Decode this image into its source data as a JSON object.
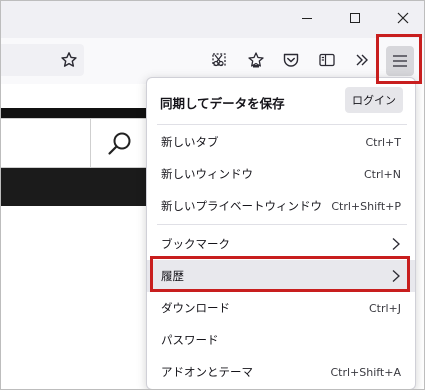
{
  "window_controls": {
    "minimize_icon": "minimize-icon",
    "maximize_icon": "maximize-icon",
    "close_icon": "close-icon"
  },
  "toolbar": {
    "icons": [
      "star-icon",
      "screenshot-icon",
      "extensions-icon",
      "pocket-icon",
      "reader-view-icon",
      "overflow-chevrons-icon",
      "hamburger-menu-icon"
    ]
  },
  "app_menu": {
    "sync_title": "同期してデータを保存",
    "login_label": "ログイン",
    "items": [
      {
        "label": "新しいタブ",
        "shortcut": "Ctrl+T"
      },
      {
        "label": "新しいウィンドウ",
        "shortcut": "Ctrl+N"
      },
      {
        "label": "新しいプライベートウィンドウ",
        "shortcut": "Ctrl+Shift+P"
      },
      {
        "label": "ブックマーク",
        "shortcut": ""
      },
      {
        "label": "履歴",
        "shortcut": ""
      },
      {
        "label": "ダウンロード",
        "shortcut": "Ctrl+J"
      },
      {
        "label": "パスワード",
        "shortcut": ""
      },
      {
        "label": "アドオンとテーマ",
        "shortcut": "Ctrl+Shift+A"
      }
    ]
  },
  "colors": {
    "highlight": "#c81e1e",
    "menu_button_bg": "#d7d7db",
    "hover_bg": "#e8e8ed"
  }
}
